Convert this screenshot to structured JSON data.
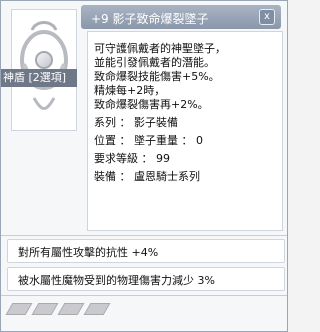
{
  "window": {
    "title": "+9 影子致命爆裂墜子",
    "close_label": "x",
    "badge": "神盾 [2選項]"
  },
  "desc": {
    "lines": [
      "可守護佩戴者的神聖墜子，",
      "並能引發佩戴者的潛能。",
      "致命爆裂技能傷害+5%。",
      "精煉每+2時，",
      "致命爆裂傷害再+2%。",
      "系列 ： 影子裝備",
      "位置 ： 墜子重量 ： 0",
      "要求等級 ： 99",
      "裝備 ： 盧恩騎士系列"
    ]
  },
  "options": [
    "對所有屬性攻擊的抗性 +4%",
    "被水屬性魔物受到的物理傷害力減少 3%"
  ]
}
